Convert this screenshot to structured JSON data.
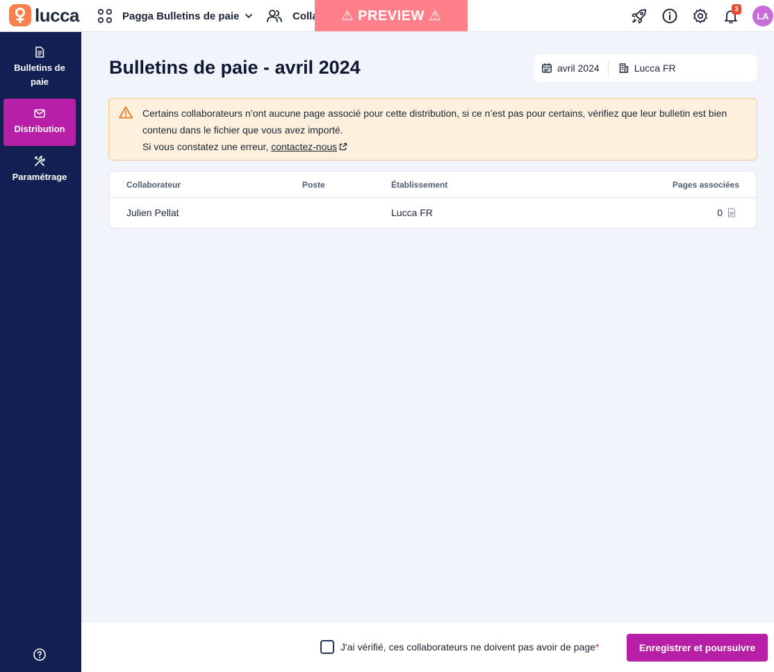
{
  "topbar": {
    "logo_text": "lucca",
    "app_name": "Pagga Bulletins de paie",
    "collab_label": "Colla",
    "preview_label": "⚠ PREVIEW ⚠",
    "notifications_count": "3",
    "avatar_initials": "LA",
    "icons": [
      "grid-icon",
      "chevron-down-icon",
      "users-icon",
      "rocket-icon",
      "info-icon",
      "gear-icon",
      "bell-icon"
    ]
  },
  "sidebar": {
    "items": [
      {
        "label": "Bulletins de paie",
        "icon": "document-icon",
        "active": false
      },
      {
        "label": "Distribution",
        "icon": "mail-icon",
        "active": true
      },
      {
        "label": "Paramétrage",
        "icon": "tools-icon",
        "active": false
      }
    ],
    "help_icon": "help-icon"
  },
  "main": {
    "title": "Bulletins de paie - avril 2024",
    "filters": {
      "period": "avril 2024",
      "establishment": "Lucca FR"
    },
    "alert": {
      "line1": "Certains collaborateurs n’ont aucune page associé pour cette distribution, si ce n’est pas pour certains, vérifiez que leur bulletin est bien contenu dans le fichier que vous avez importé.",
      "line2_prefix": "Si vous constatez une erreur, ",
      "link_text": "contactez-nous"
    },
    "table": {
      "columns": [
        "Collaborateur",
        "Poste",
        "Établissement",
        "Pages associées"
      ],
      "rows": [
        {
          "collaborateur": "Julien Pellat",
          "poste": "",
          "etablissement": "Lucca FR",
          "pages": "0"
        }
      ]
    }
  },
  "footer": {
    "checkbox_label": "J'ai vérifié, ces collaborateurs ne doivent pas avoir de page",
    "required_mark": "*",
    "checked": false,
    "submit_label": "Enregistrer et poursuivre"
  },
  "colors": {
    "sidebar_bg": "#121f52",
    "accent": "#b71fa6",
    "preview_bg": "#ff7f8a",
    "alert_bg": "#fdf1dd",
    "logo": "#f97f4d"
  }
}
